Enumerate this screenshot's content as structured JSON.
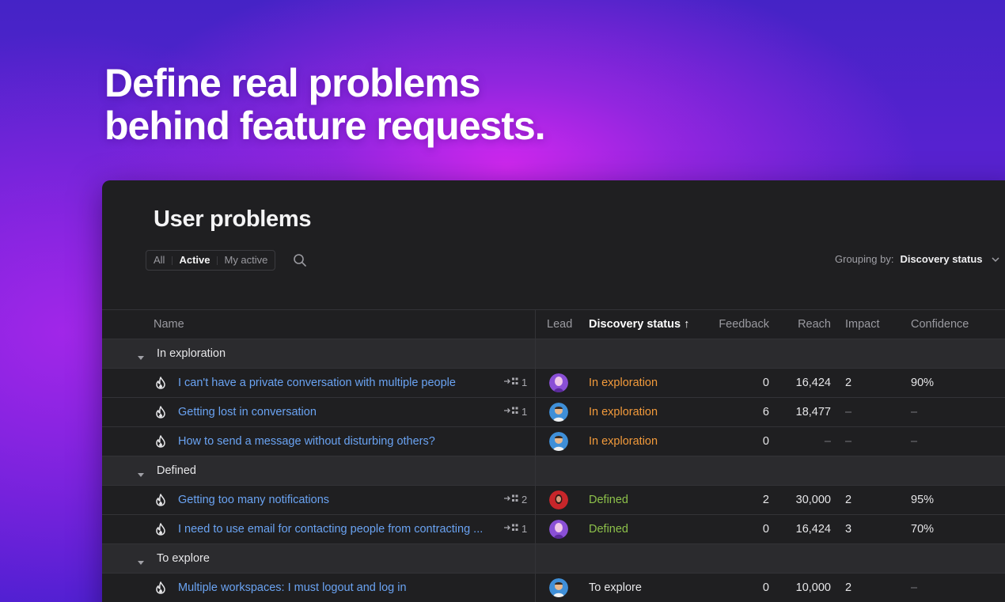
{
  "headline": [
    "Define real problems",
    "behind feature requests."
  ],
  "panel": {
    "title": "User problems",
    "filters": [
      "All",
      "Active",
      "My active"
    ],
    "active_filter": "Active",
    "grouping_label": "Grouping by:",
    "grouping_value": "Discovery status"
  },
  "columns": {
    "name": "Name",
    "lead": "Lead",
    "status": "Discovery status ↑",
    "feedback": "Feedback",
    "reach": "Reach",
    "impact": "Impact",
    "confidence": "Confidence"
  },
  "groups": [
    {
      "label": "In exploration",
      "rows": [
        {
          "name": "I can't have a private conversation with multiple people",
          "links": "1",
          "avatar": "purple",
          "status": "In exploration",
          "feedback": "0",
          "reach": "16,424",
          "impact": "2",
          "confidence": "90%"
        },
        {
          "name": "Getting lost in conversation",
          "links": "1",
          "avatar": "blue",
          "status": "In exploration",
          "feedback": "6",
          "reach": "18,477",
          "impact": "–",
          "confidence": "–"
        },
        {
          "name": "How to send a message without disturbing others?",
          "links": "",
          "avatar": "blue",
          "status": "In exploration",
          "feedback": "0",
          "reach": "–",
          "impact": "–",
          "confidence": "–"
        }
      ]
    },
    {
      "label": "Defined",
      "rows": [
        {
          "name": "Getting too many notifications",
          "links": "2",
          "avatar": "red",
          "status": "Defined",
          "feedback": "2",
          "reach": "30,000",
          "impact": "2",
          "confidence": "95%"
        },
        {
          "name": "I need to use email for contacting people from contracting ...",
          "links": "1",
          "avatar": "purple",
          "status": "Defined",
          "feedback": "0",
          "reach": "16,424",
          "impact": "3",
          "confidence": "70%"
        }
      ]
    },
    {
      "label": "To explore",
      "rows": [
        {
          "name": "Multiple workspaces: I must logout and log in",
          "links": "",
          "avatar": "blue",
          "status": "To explore",
          "feedback": "0",
          "reach": "10,000",
          "impact": "2",
          "confidence": "–"
        }
      ]
    }
  ],
  "colors": {
    "link": "#6aa3f2",
    "in_exploration": "#f29a3b",
    "defined": "#8cc04a",
    "panel_bg": "#1f1f21"
  },
  "icons": [
    "fire-icon",
    "linked-items-icon",
    "search-icon",
    "chevron-down-icon",
    "caret-down-icon"
  ]
}
